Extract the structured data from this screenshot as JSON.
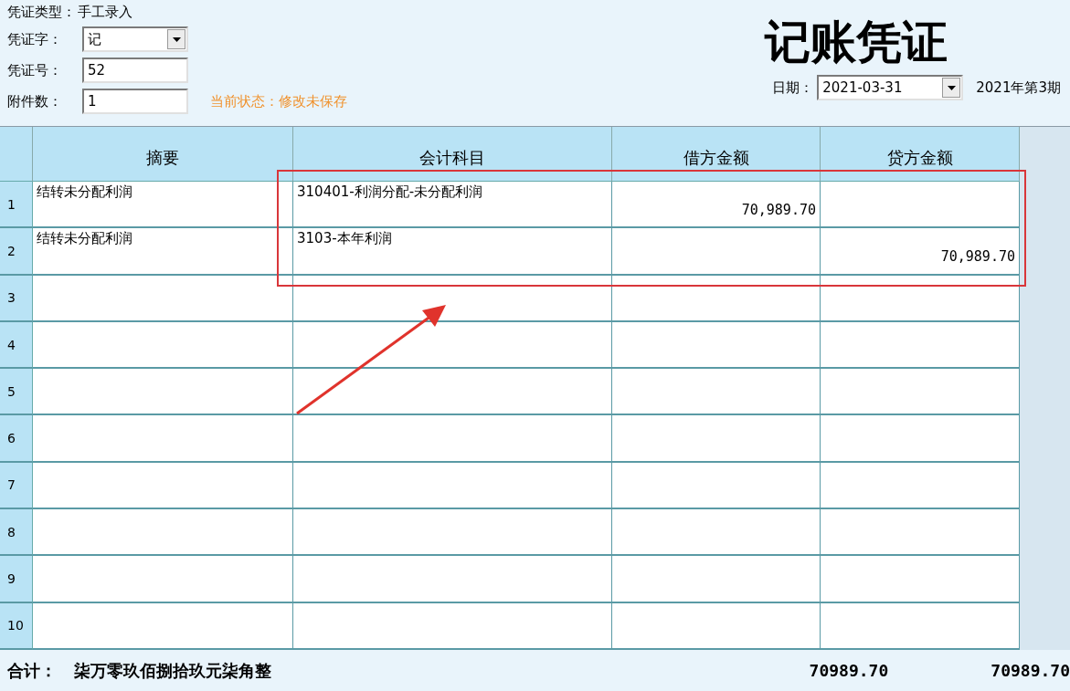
{
  "header": {
    "voucher_type_label": "凭证类型：",
    "voucher_type": "手工录入",
    "voucher_word_label": "凭证字：",
    "voucher_word": "记",
    "voucher_no_label": "凭证号：",
    "voucher_no": "52",
    "attachments_label": "附件数：",
    "attachments": "1",
    "status": "当前状态：修改未保存",
    "title": "记账凭证",
    "date_label": "日期：",
    "date": "2021-03-31",
    "period": "2021年第3期"
  },
  "table": {
    "columns": [
      "摘要",
      "会计科目",
      "借方金额",
      "贷方金额"
    ],
    "rows": [
      {
        "no": "1",
        "summary": "结转未分配利润",
        "account": "310401-利润分配-未分配利润",
        "debit": "70,989.70",
        "credit": ""
      },
      {
        "no": "2",
        "summary": "结转未分配利润",
        "account": "3103-本年利润",
        "debit": "",
        "credit": "70,989.70"
      },
      {
        "no": "3"
      },
      {
        "no": "4"
      },
      {
        "no": "5"
      },
      {
        "no": "6"
      },
      {
        "no": "7"
      },
      {
        "no": "8"
      },
      {
        "no": "9"
      },
      {
        "no": "10"
      }
    ]
  },
  "footer": {
    "label": "合计：",
    "amount_words": "柒万零玖佰捌拾玖元柒角整",
    "debit_total": "70989.70",
    "credit_total": "70989.70"
  }
}
